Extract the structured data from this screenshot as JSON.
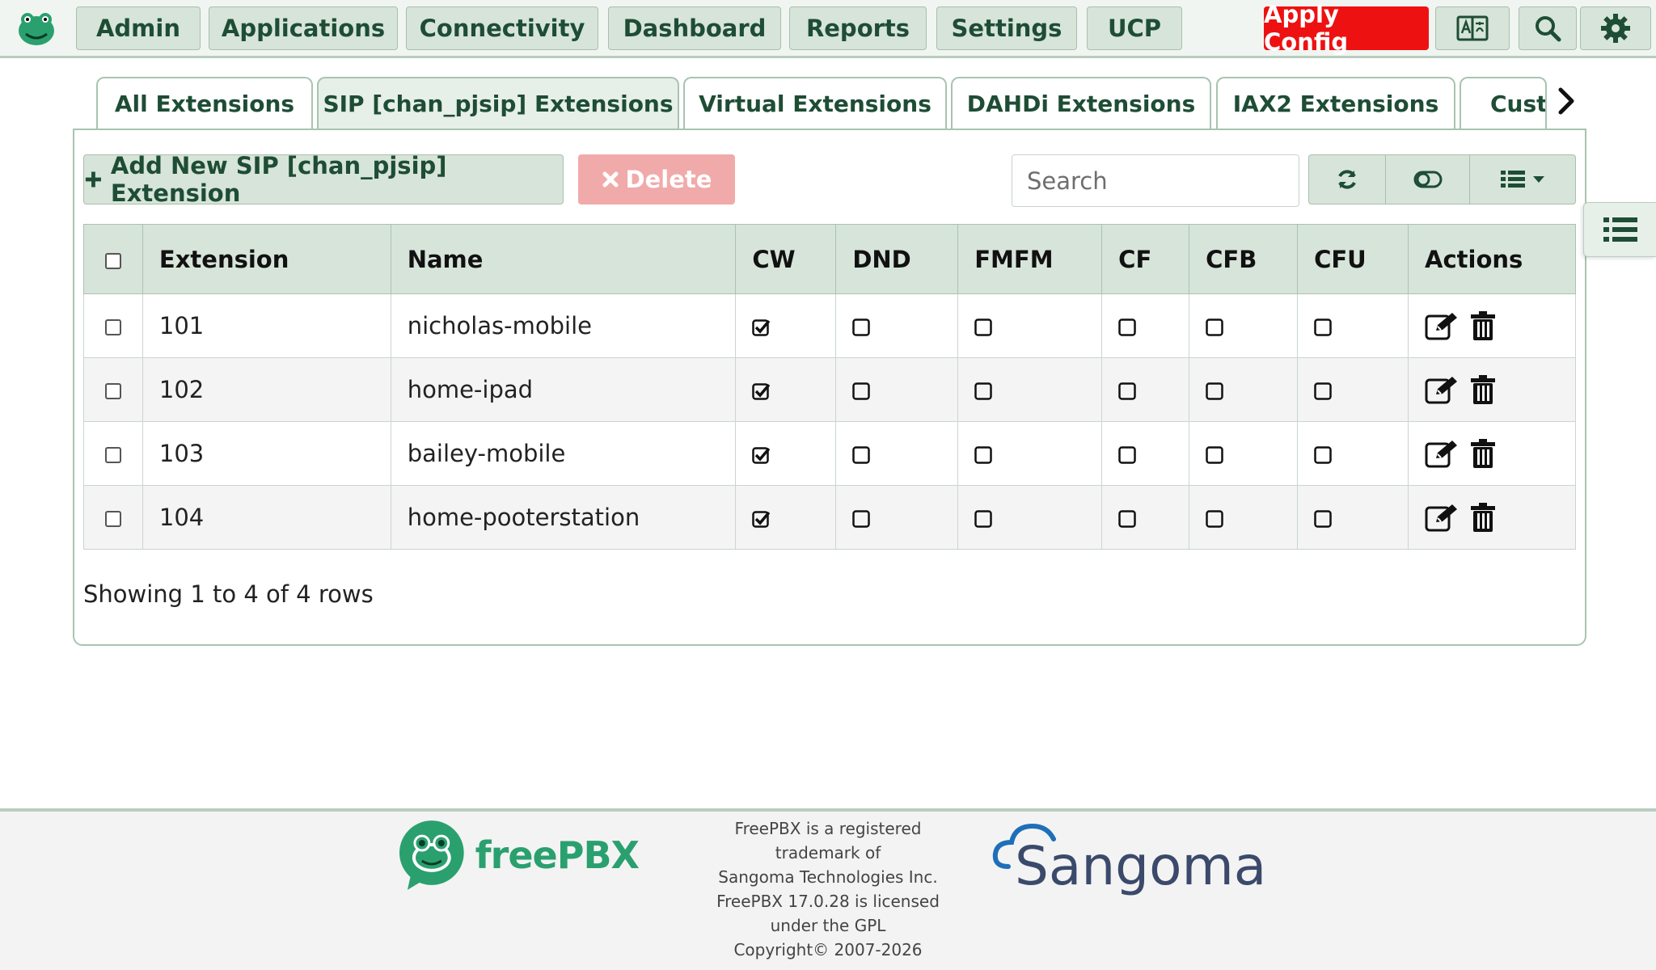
{
  "nav": {
    "items": [
      "Admin",
      "Applications",
      "Connectivity",
      "Dashboard",
      "Reports",
      "Settings",
      "UCP"
    ],
    "apply_label": "Apply Config",
    "icons": [
      "language-icon",
      "search-icon",
      "gear-icon"
    ]
  },
  "tabs": [
    "All Extensions",
    "SIP [chan_pjsip] Extensions",
    "Virtual Extensions",
    "DAHDi Extensions",
    "IAX2 Extensions",
    "Custc"
  ],
  "toolbar": {
    "add_label": "Add New SIP [chan_pjsip] Extension",
    "delete_label": "Delete",
    "search_placeholder": "Search"
  },
  "table": {
    "columns": [
      "Extension",
      "Name",
      "CW",
      "DND",
      "FMFM",
      "CF",
      "CFB",
      "CFU",
      "Actions"
    ],
    "rows": [
      {
        "extension": "101",
        "name": "nicholas-mobile",
        "cw": true,
        "dnd": false,
        "fmfm": false,
        "cf": false,
        "cfb": false,
        "cfu": false
      },
      {
        "extension": "102",
        "name": "home-ipad",
        "cw": true,
        "dnd": false,
        "fmfm": false,
        "cf": false,
        "cfb": false,
        "cfu": false
      },
      {
        "extension": "103",
        "name": "bailey-mobile",
        "cw": true,
        "dnd": false,
        "fmfm": false,
        "cf": false,
        "cfb": false,
        "cfu": false
      },
      {
        "extension": "104",
        "name": "home-pooterstation",
        "cw": true,
        "dnd": false,
        "fmfm": false,
        "cf": false,
        "cfb": false,
        "cfu": false
      }
    ],
    "pagination": "Showing 1 to 4 of 4 rows"
  },
  "footer": {
    "brand": "freePBX",
    "legal_lines": [
      "FreePBX is a registered",
      "trademark of",
      "Sangoma Technologies Inc.",
      "FreePBX 17.0.28 is licensed",
      "under the GPL",
      "Copyright© 2007-2026"
    ],
    "partner": "Sangoma"
  },
  "colors": {
    "accent": "#1e4d35",
    "button_bg": "#d7e4da",
    "apply": "#ee1111",
    "delete_disabled": "#f1aaaa",
    "brand_green": "#2aa06f",
    "sangoma_blue": "#1e6fb8"
  }
}
